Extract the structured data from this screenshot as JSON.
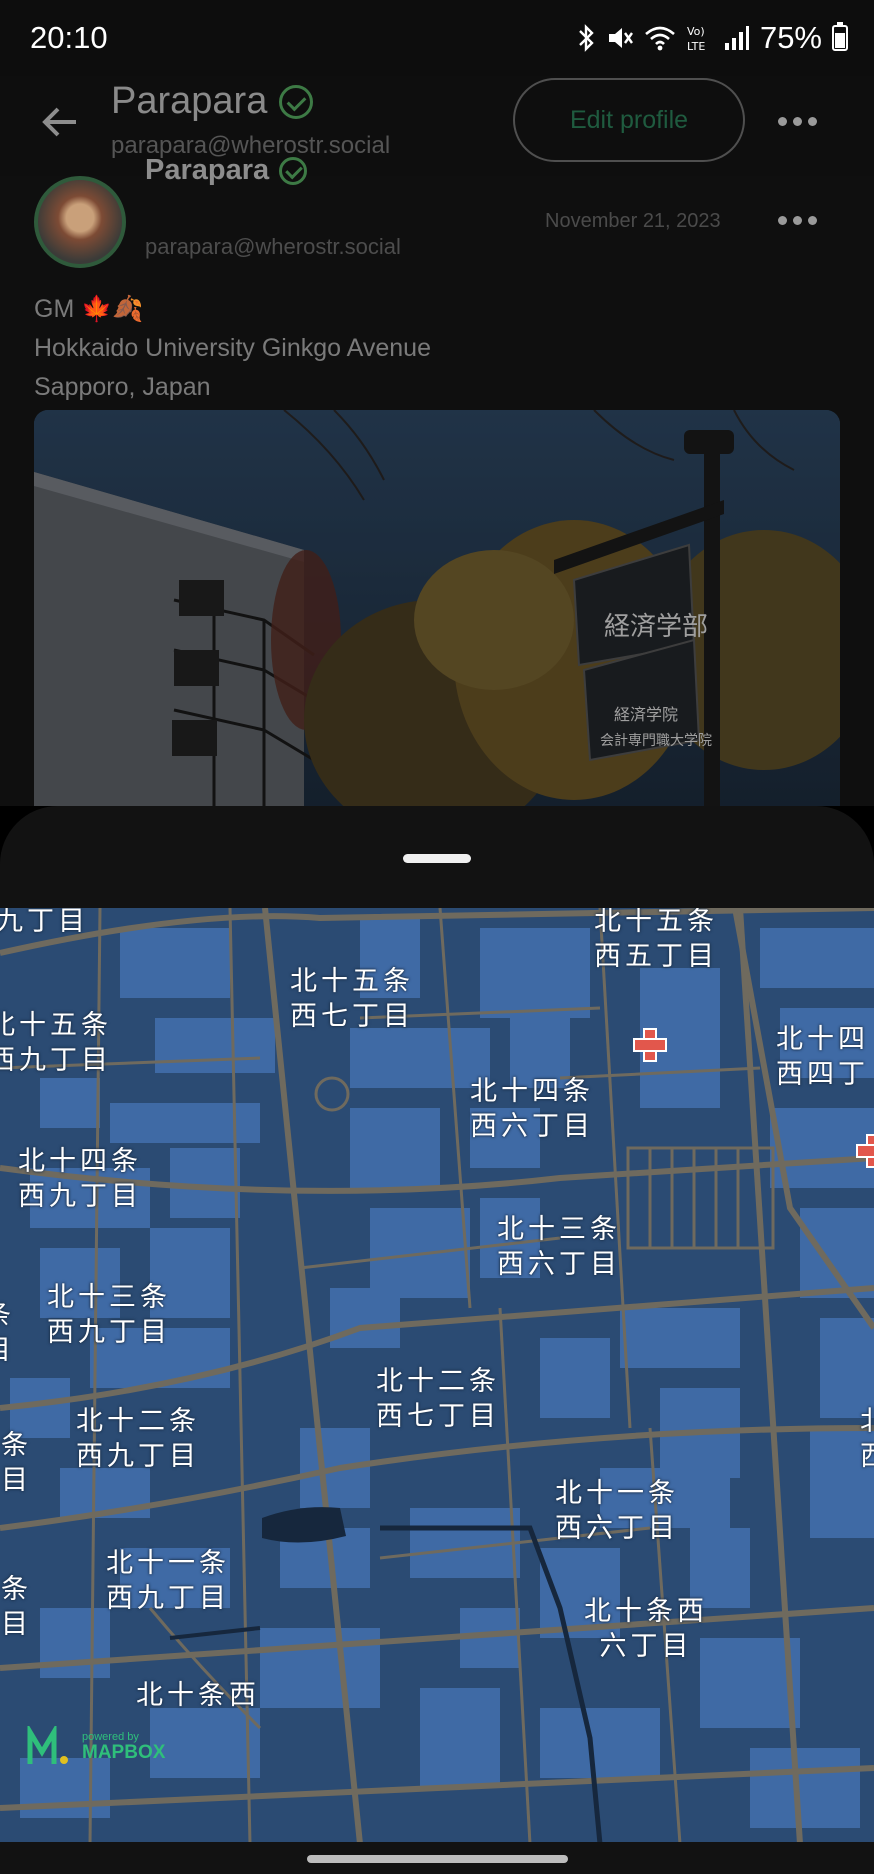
{
  "status_bar": {
    "time": "20:10",
    "battery": "75%",
    "icons": [
      "bluetooth-icon",
      "mute-icon",
      "wifi-icon",
      "volte-icon",
      "signal-icon",
      "battery-icon"
    ]
  },
  "header": {
    "title": "Parapara",
    "handle": "parapara@wherostr.social",
    "edit_button": "Edit profile"
  },
  "post": {
    "author": "Parapara",
    "handle": "parapara@wherostr.social",
    "date": "November 21, 2023",
    "text_line1": "GM 🍁🍂",
    "text_line2": "Hokkaido University Ginkgo Avenue",
    "text_line3": "Sapporo, Japan",
    "sign_text_1": "経済学部",
    "sign_text_2": "経済学院",
    "sign_text_3": "会計専門職大学院"
  },
  "map": {
    "labels": [
      "九丁目",
      "北十五条\n西五丁目",
      "北十五条\n西七丁目",
      "北十五条\n西九丁目",
      "北十四\n西四丁",
      "北十四条\n西六丁目",
      "北十四条\n西九丁目",
      "北十三条\n西六丁目",
      "北十三条\n西九丁目",
      "条\n目",
      "北十二条\n西七丁目",
      "北十二条\n西九丁目",
      "二条\n丁目",
      "北十一条\n西六丁目",
      "北十一条\n西九丁目",
      "一条\n丁目",
      "北十条西\n六丁目",
      "北十条西",
      "北\n西"
    ],
    "attribution_small": "powered by",
    "attribution_brand": "MAPBOX"
  },
  "colors": {
    "map_water": "#2b4b73",
    "map_building": "#3f6aa5",
    "map_road": "#6f6a5e",
    "accent_green": "#2f5a3b",
    "hospital_red": "#e2574c"
  }
}
